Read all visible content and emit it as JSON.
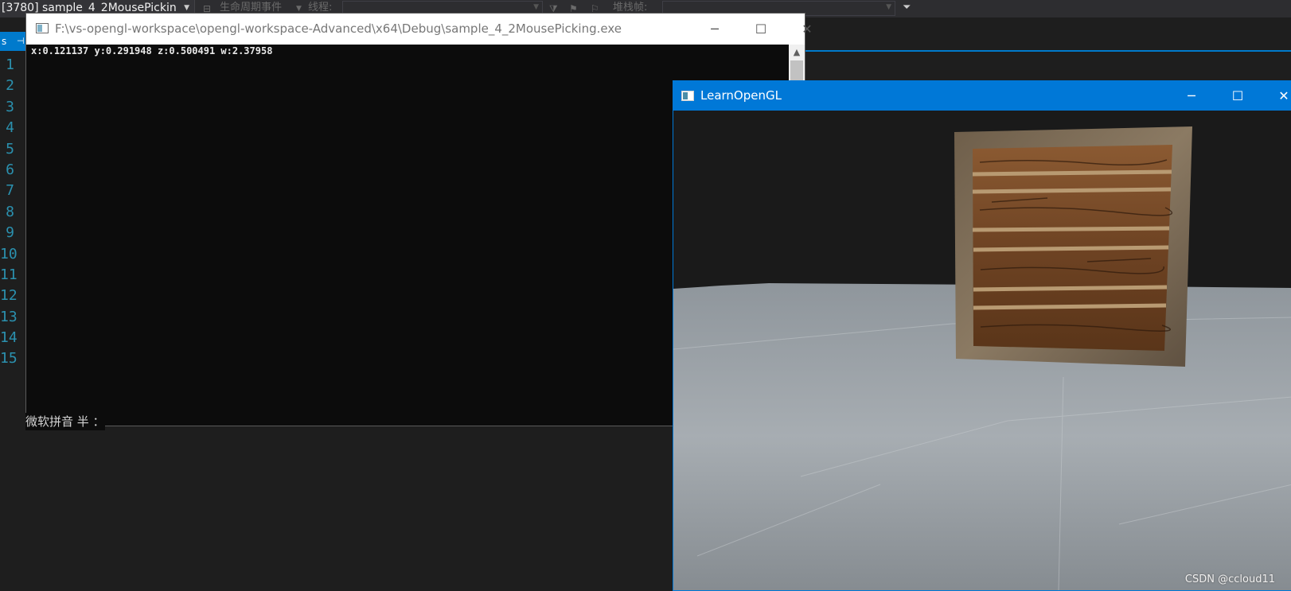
{
  "vs": {
    "process_label": "[3780] sample_4_2MousePickin",
    "lifecycle_label": "生命周期事件",
    "thread_label": "线程:",
    "stack_frame_label": "堆栈帧:",
    "tab_label": "s",
    "line_numbers": [
      "1",
      "2",
      "3",
      "4",
      "5",
      "6",
      "7",
      "8",
      "9",
      "10",
      "11",
      "12",
      "13",
      "14",
      "15"
    ]
  },
  "console": {
    "title": "F:\\vs-opengl-workspace\\opengl-workspace-Advanced\\x64\\Debug\\sample_4_2MousePicking.exe",
    "output": "x:0.121137 y:0.291948 z:0.500491 w:2.37958",
    "ime_status": "微软拼音 半 ："
  },
  "gl": {
    "title": "LearnOpenGL",
    "watermark": "CSDN @ccloud11"
  },
  "colors": {
    "vs_background": "#1e1e1e",
    "vs_accent": "#007acc",
    "gl_titlebar": "#0078d7",
    "console_bg": "#0c0c0c",
    "line_number": "#2b91af"
  },
  "icons": {
    "minimize": "minimize-icon",
    "maximize": "maximize-icon",
    "close": "close-icon"
  }
}
